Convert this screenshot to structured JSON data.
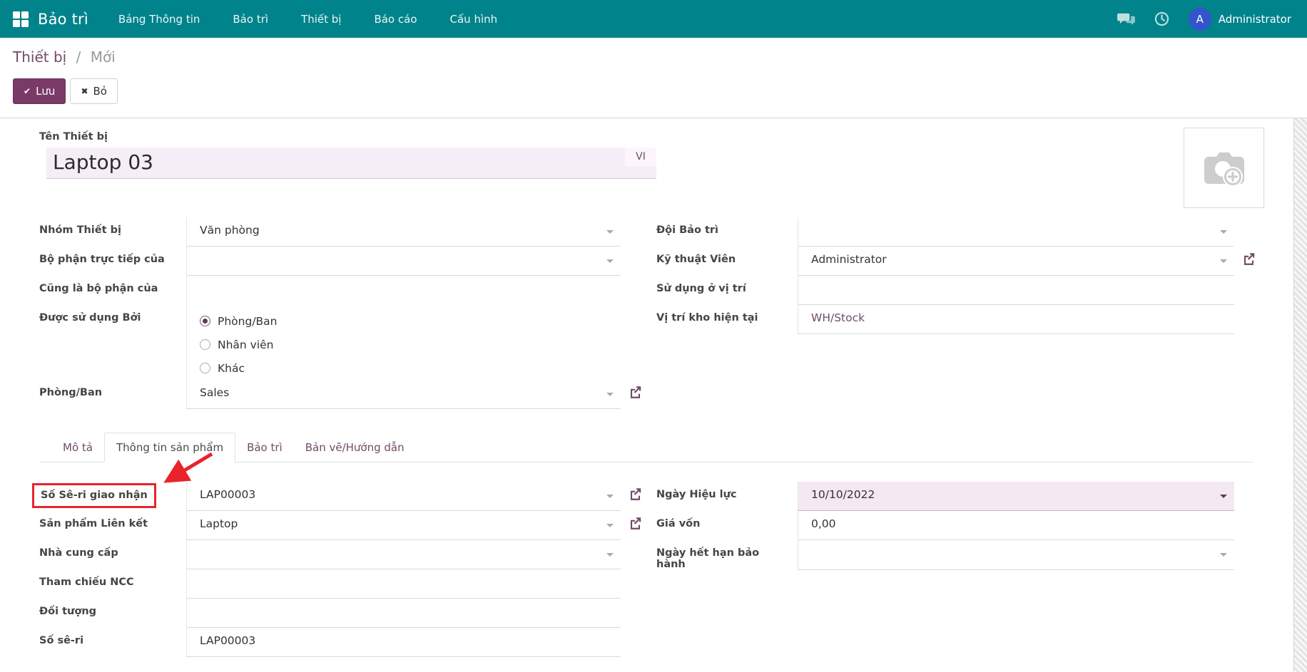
{
  "colors": {
    "navbar_teal": "#00838A",
    "accent_purple": "#714B67",
    "primary_button": "#7A3A68",
    "annotation_red": "#E9232B",
    "highlight_lavender": "#F4E8F3",
    "avatar_blue": "#3553CE"
  },
  "navbar": {
    "app_name": "Bảo trì",
    "menu": [
      "Bảng Thông tin",
      "Bảo trì",
      "Thiết bị",
      "Báo cáo",
      "Cấu hình"
    ],
    "user": {
      "initial": "A",
      "name": "Administrator"
    }
  },
  "breadcrumb": {
    "parent": "Thiết bị",
    "separator": "/",
    "current": "Mới"
  },
  "control_panel": {
    "save": "Lưu",
    "discard": "Bỏ",
    "save_icon": "✔",
    "discard_icon": "✖"
  },
  "form": {
    "title": {
      "label": "Tên Thiết bị",
      "value": "Laptop 03",
      "lang_badge": "VI"
    },
    "groups": {
      "main_left": [
        {
          "name": "nhom-thiet-bi",
          "label": "Nhóm Thiết bị",
          "value": "Văn phòng",
          "type": "m2o"
        },
        {
          "name": "bo-phan-truc-tiep-cua",
          "label": "Bộ phận trực tiếp của",
          "value": "",
          "type": "m2o"
        },
        {
          "name": "cung-la-bo-phan-cua",
          "label": "Cũng là bộ phận của",
          "value": "",
          "type": "blank"
        },
        {
          "name": "duoc-su-dung-boi",
          "label": "Được sử dụng Bởi",
          "type": "radio",
          "options": [
            {
              "name": "phong-ban",
              "label": "Phòng/Ban",
              "selected": true
            },
            {
              "name": "nhan-vien",
              "label": "Nhân viên",
              "selected": false
            },
            {
              "name": "khac",
              "label": "Khác",
              "selected": false
            }
          ]
        },
        {
          "name": "phong-ban",
          "label": "Phòng/Ban",
          "value": "Sales",
          "type": "m2o_ext"
        }
      ],
      "main_right": [
        {
          "name": "doi-bao-tri",
          "label": "Đội Bảo trì",
          "value": "",
          "type": "m2o"
        },
        {
          "name": "ky-thuat-vien",
          "label": "Kỹ thuật Viên",
          "value": "Administrator",
          "type": "m2o_ext"
        },
        {
          "name": "su-dung-o-vi-tri",
          "label": "Sử dụng ở vị trí",
          "value": "",
          "type": "char"
        },
        {
          "name": "vi-tri-kho-hien-tai",
          "label": "Vị trí kho hiện tại",
          "value": "WH/Stock",
          "type": "link"
        }
      ],
      "tab_left": [
        {
          "name": "so-se-ri-giao-nhan",
          "label": "Số Sê-ri giao nhận",
          "value": "LAP00003",
          "type": "m2o_ext",
          "boxed": true
        },
        {
          "name": "san-pham-lien-ket",
          "label": "Sản phẩm Liên kết",
          "value": "Laptop",
          "type": "m2o_ext"
        },
        {
          "name": "nha-cung-cap",
          "label": "Nhà cung cấp",
          "value": "",
          "type": "m2o"
        },
        {
          "name": "tham-chieu-ncc",
          "label": "Tham chiếu NCC",
          "value": "",
          "type": "char"
        },
        {
          "name": "doi-tuong",
          "label": "Đối tượng",
          "value": "",
          "type": "char"
        },
        {
          "name": "so-se-ri",
          "label": "Số sê-ri",
          "value": "LAP00003",
          "type": "char"
        }
      ],
      "tab_right": [
        {
          "name": "ngay-hieu-luc",
          "label": "Ngày Hiệu lực",
          "value": "10/10/2022",
          "type": "date",
          "highlight": true
        },
        {
          "name": "gia-von",
          "label": "Giá vốn",
          "value": "0,00",
          "type": "char"
        },
        {
          "name": "ngay-het-han-bao-hanh",
          "label": "Ngày hết hạn bảo hành",
          "value": "",
          "type": "date",
          "highlight": false
        }
      ]
    }
  },
  "tabs": [
    {
      "label": "Mô tả",
      "active": false
    },
    {
      "label": "Thông tin sản phẩm",
      "active": true
    },
    {
      "label": "Bảo trì",
      "active": false
    },
    {
      "label": "Bản vẽ/Hướng dẫn",
      "active": false
    }
  ],
  "annotation": {
    "shape": "box-and-arrow",
    "color": "#E9232B",
    "target_field": "so-se-ri-giao-nhan"
  }
}
